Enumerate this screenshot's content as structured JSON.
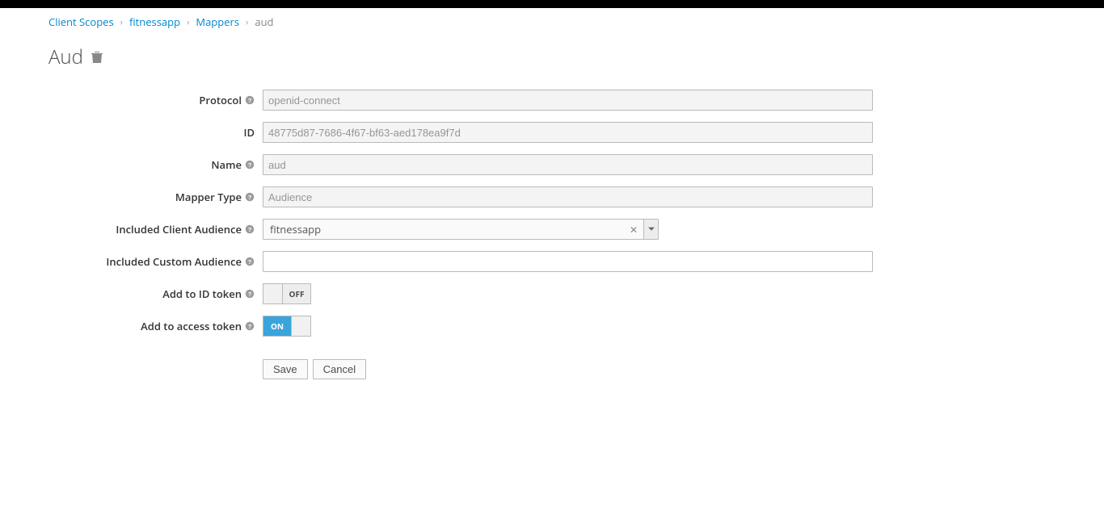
{
  "breadcrumb": {
    "item1": "Client Scopes",
    "item2": "fitnessapp",
    "item3": "Mappers",
    "item4": "aud"
  },
  "page": {
    "title": "Aud"
  },
  "labels": {
    "protocol": "Protocol",
    "id": "ID",
    "name": "Name",
    "mapper_type": "Mapper Type",
    "included_client_audience": "Included Client Audience",
    "included_custom_audience": "Included Custom Audience",
    "add_to_id_token": "Add to ID token",
    "add_to_access_token": "Add to access token"
  },
  "values": {
    "protocol": "openid-connect",
    "id": "48775d87-7686-4f67-bf63-aed178ea9f7d",
    "name": "aud",
    "mapper_type": "Audience",
    "included_client_audience": "fitnessapp",
    "included_custom_audience": ""
  },
  "toggles": {
    "add_to_id_token": {
      "on": false,
      "label_off": "OFF",
      "label_on": "ON"
    },
    "add_to_access_token": {
      "on": true,
      "label_off": "OFF",
      "label_on": "ON"
    }
  },
  "buttons": {
    "save": "Save",
    "cancel": "Cancel"
  }
}
